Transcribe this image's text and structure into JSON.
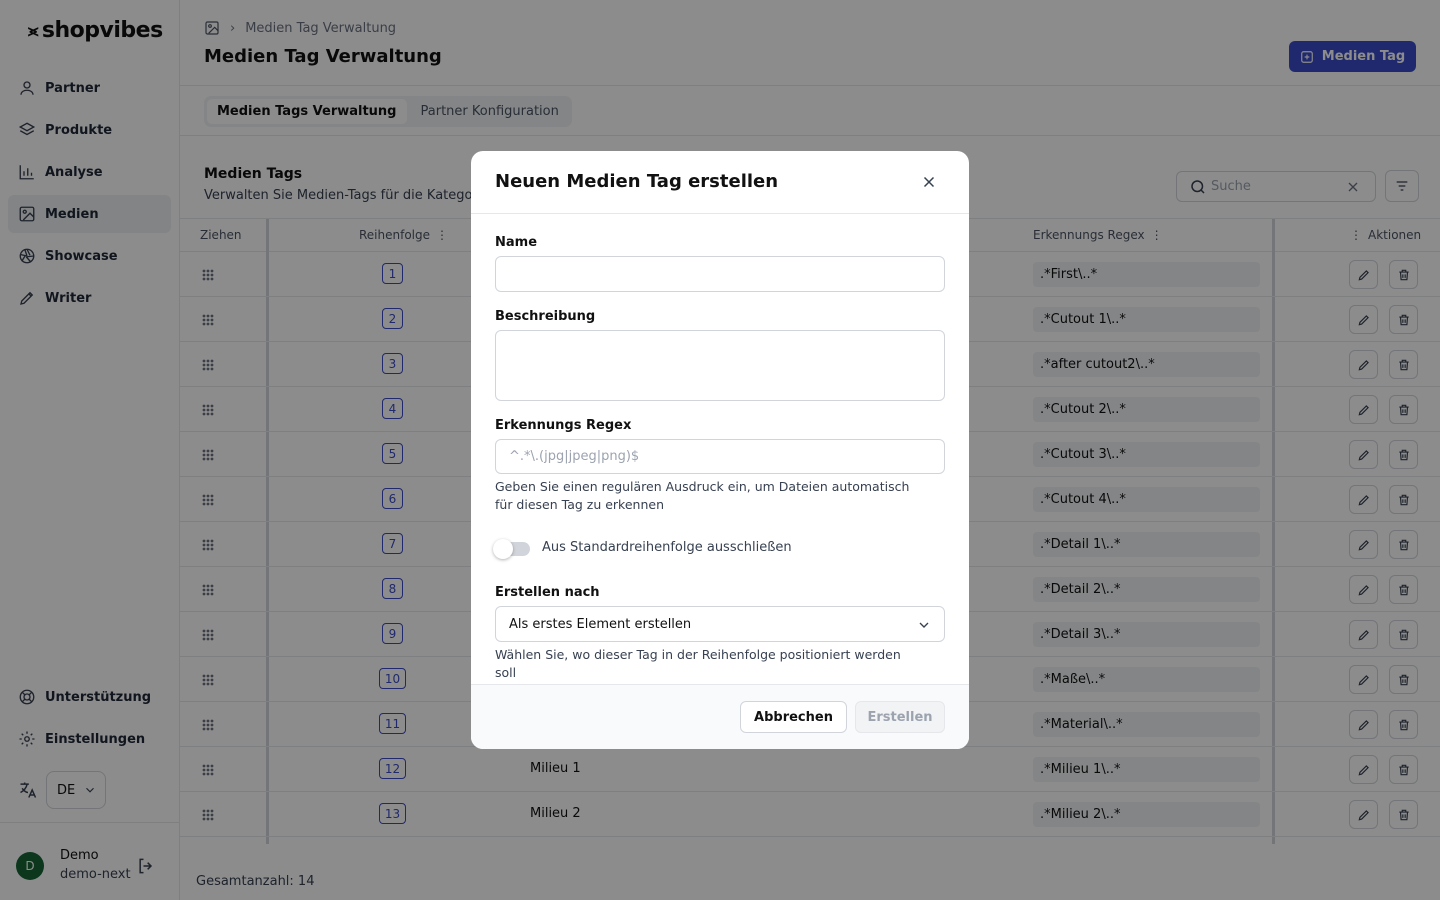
{
  "brand": {
    "name": "shopvibes"
  },
  "sidebar": {
    "items": [
      {
        "label": "Partner",
        "icon": "user-icon"
      },
      {
        "label": "Produkte",
        "icon": "layers-icon"
      },
      {
        "label": "Analyse",
        "icon": "bar-chart-icon"
      },
      {
        "label": "Medien",
        "icon": "image-icon",
        "active": true
      },
      {
        "label": "Showcase",
        "icon": "aperture-icon"
      },
      {
        "label": "Writer",
        "icon": "pen-icon"
      }
    ],
    "bottom": [
      {
        "label": "Unterstützung",
        "icon": "lifebuoy-icon"
      },
      {
        "label": "Einstellungen",
        "icon": "gear-icon"
      }
    ],
    "language": "DE",
    "user": {
      "initial": "D",
      "name": "Demo",
      "org": "demo-next"
    }
  },
  "header": {
    "breadcrumb": "Medien Tag Verwaltung",
    "title": "Medien Tag Verwaltung",
    "primary_button": "Medien Tag"
  },
  "tabs": [
    "Medien Tags Verwaltung",
    "Partner Konfiguration"
  ],
  "section": {
    "title": "Medien Tags",
    "description": "Verwalten Sie Medien-Tags für die Kategorisierung"
  },
  "search": {
    "placeholder": "Suche"
  },
  "table": {
    "columns": {
      "drag": "Ziehen",
      "order": "Reihenfolge",
      "regex": "Erkennungs Regex",
      "actions": "Aktionen"
    },
    "rows": [
      {
        "order": "1",
        "name": "",
        "regex": ".*First\\..*"
      },
      {
        "order": "2",
        "name": "",
        "regex": ".*Cutout 1\\..*"
      },
      {
        "order": "3",
        "name": "",
        "regex": ".*after cutout2\\..*"
      },
      {
        "order": "4",
        "name": "",
        "regex": ".*Cutout 2\\..*"
      },
      {
        "order": "5",
        "name": "",
        "regex": ".*Cutout 3\\..*"
      },
      {
        "order": "6",
        "name": "",
        "regex": ".*Cutout 4\\..*"
      },
      {
        "order": "7",
        "name": "",
        "regex": ".*Detail 1\\..*"
      },
      {
        "order": "8",
        "name": "",
        "regex": ".*Detail 2\\..*"
      },
      {
        "order": "9",
        "name": "",
        "regex": ".*Detail 3\\..*"
      },
      {
        "order": "10",
        "name": "",
        "regex": ".*Maße\\..*"
      },
      {
        "order": "11",
        "name": "",
        "regex": ".*Material\\..*"
      },
      {
        "order": "12",
        "name": "Milieu 1",
        "regex": ".*Milieu 1\\..*"
      },
      {
        "order": "13",
        "name": "Milieu 2",
        "regex": ".*Milieu 2\\..*"
      }
    ]
  },
  "footer": {
    "total": "Gesamtanzahl: 14"
  },
  "modal": {
    "title": "Neuen Medien Tag erstellen",
    "name_label": "Name",
    "name_value": "",
    "description_label": "Beschreibung",
    "description_value": "",
    "regex_label": "Erkennungs Regex",
    "regex_placeholder": "^.*\\.(jpg|jpeg|png)$",
    "regex_help": "Geben Sie einen regulären Ausdruck ein, um Dateien automatisch für diesen Tag zu erkennen",
    "toggle_label": "Aus Standardreihenfolge ausschließen",
    "toggle_on": false,
    "create_after_label": "Erstellen nach",
    "create_after_value": "Als erstes Element erstellen",
    "create_after_help": "Wählen Sie, wo dieser Tag in der Reihenfolge positioniert werden soll",
    "cancel_button": "Abbrechen",
    "create_button": "Erstellen"
  },
  "colors": {
    "accent": "#3b4cc6",
    "avatar": "#166534"
  }
}
